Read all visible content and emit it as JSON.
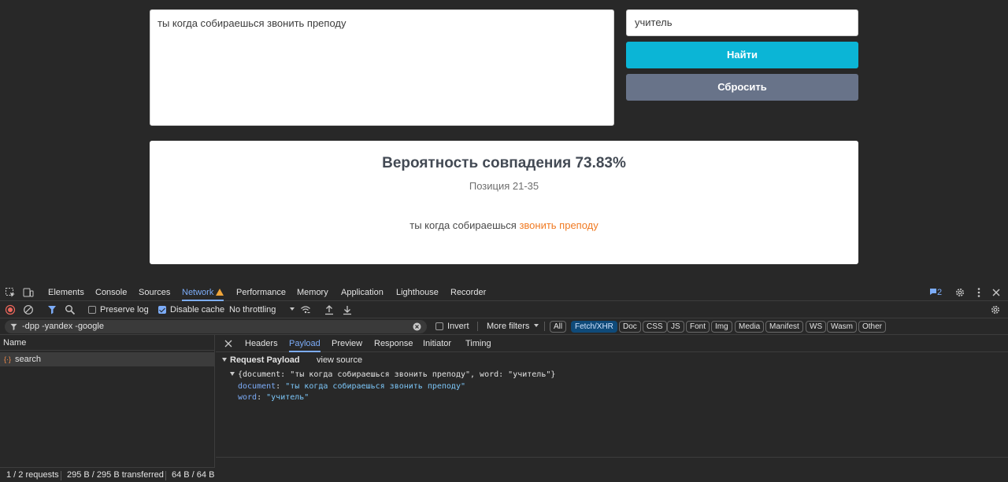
{
  "page": {
    "document_text": "ты когда собираешься звонить преподу",
    "word_value": "учитель",
    "find_label": "Найти",
    "reset_label": "Сбросить",
    "result": {
      "title": "Вероятность совпадения 73.83%",
      "position": "Позиция 21-35",
      "text_plain": "ты когда собираешься ",
      "text_highlight": "звонить преподу"
    }
  },
  "devtools": {
    "tabs": [
      "Elements",
      "Console",
      "Sources",
      "Network",
      "Performance",
      "Memory",
      "Application",
      "Lighthouse",
      "Recorder"
    ],
    "active_tab": "Network",
    "issues_count": "2",
    "toolbar": {
      "preserve_log": "Preserve log",
      "disable_cache": "Disable cache",
      "throttling": "No throttling"
    },
    "filter": {
      "value": "-dpp -yandex -google",
      "invert": "Invert",
      "more_filters": "More filters",
      "chips": [
        "All",
        "Fetch/XHR",
        "Doc",
        "CSS",
        "JS",
        "Font",
        "Img",
        "Media",
        "Manifest",
        "WS",
        "Wasm",
        "Other"
      ],
      "active_chip": "Fetch/XHR"
    },
    "requests": {
      "header": "Name",
      "items": [
        "search"
      ]
    },
    "detail": {
      "tabs": [
        "Headers",
        "Payload",
        "Preview",
        "Response",
        "Initiator",
        "Timing"
      ],
      "active_tab": "Payload",
      "section_title": "Request Payload",
      "view_source": "view source",
      "object_summary": "{document: \"ты когда собираешься звонить преподу\", word: \"учитель\"}",
      "fields": [
        {
          "key": "document",
          "value": "\"ты когда собираешься звонить преподу\""
        },
        {
          "key": "word",
          "value": "\"учитель\""
        }
      ]
    },
    "status": {
      "requests": "1 / 2 requests",
      "transferred": "295 B / 295 B transferred",
      "resources": "64 B / 64 B"
    }
  }
}
